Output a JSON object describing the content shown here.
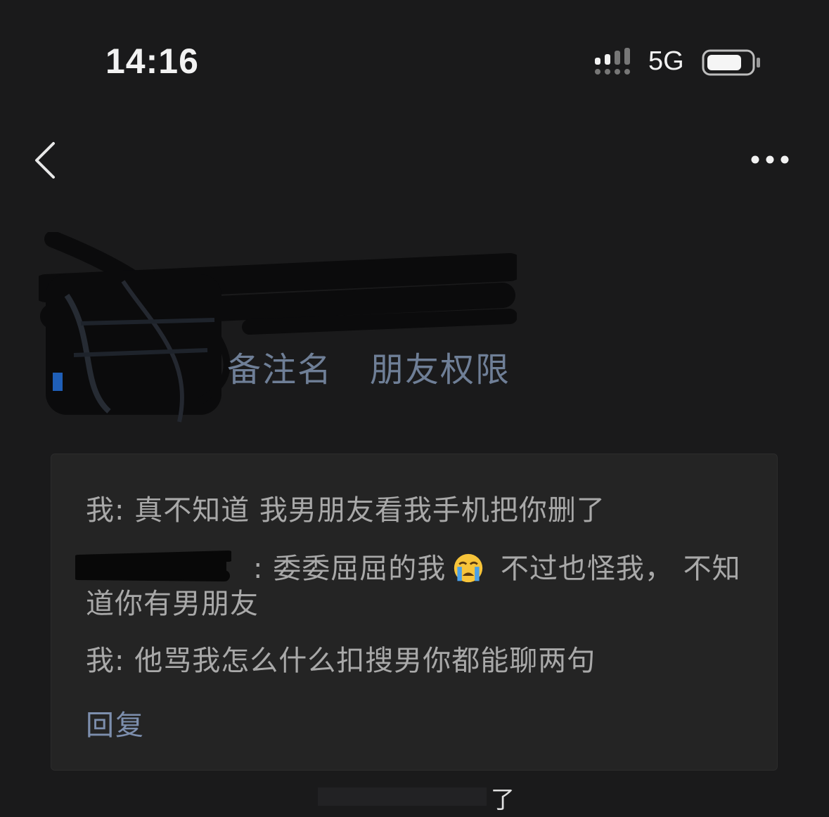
{
  "status_bar": {
    "time": "14:16",
    "network": "5G"
  },
  "nav": {
    "back_icon": "chevron-left-icon",
    "more_icon": "ellipsis-icon"
  },
  "profile": {
    "remark_label": "备注名",
    "permission_label": "朋友权限"
  },
  "comments": [
    {
      "text": "我: 真不知道 我男朋友看我手机把你删了"
    },
    {
      "text_before": ": 委委屈屈的我",
      "emoji": "crying-face-emoji",
      "text_after": " 不过也怪我， 不知道你有男朋友"
    },
    {
      "text": "我: 他骂我怎么什么扣搜男你都能聊两句"
    }
  ],
  "reply_label": "回复",
  "bottom_hint_visible": "了",
  "colors": {
    "background": "#1a1a1b",
    "card": "#242424",
    "link": "#7d8fae",
    "text": "#a9a9a9"
  }
}
